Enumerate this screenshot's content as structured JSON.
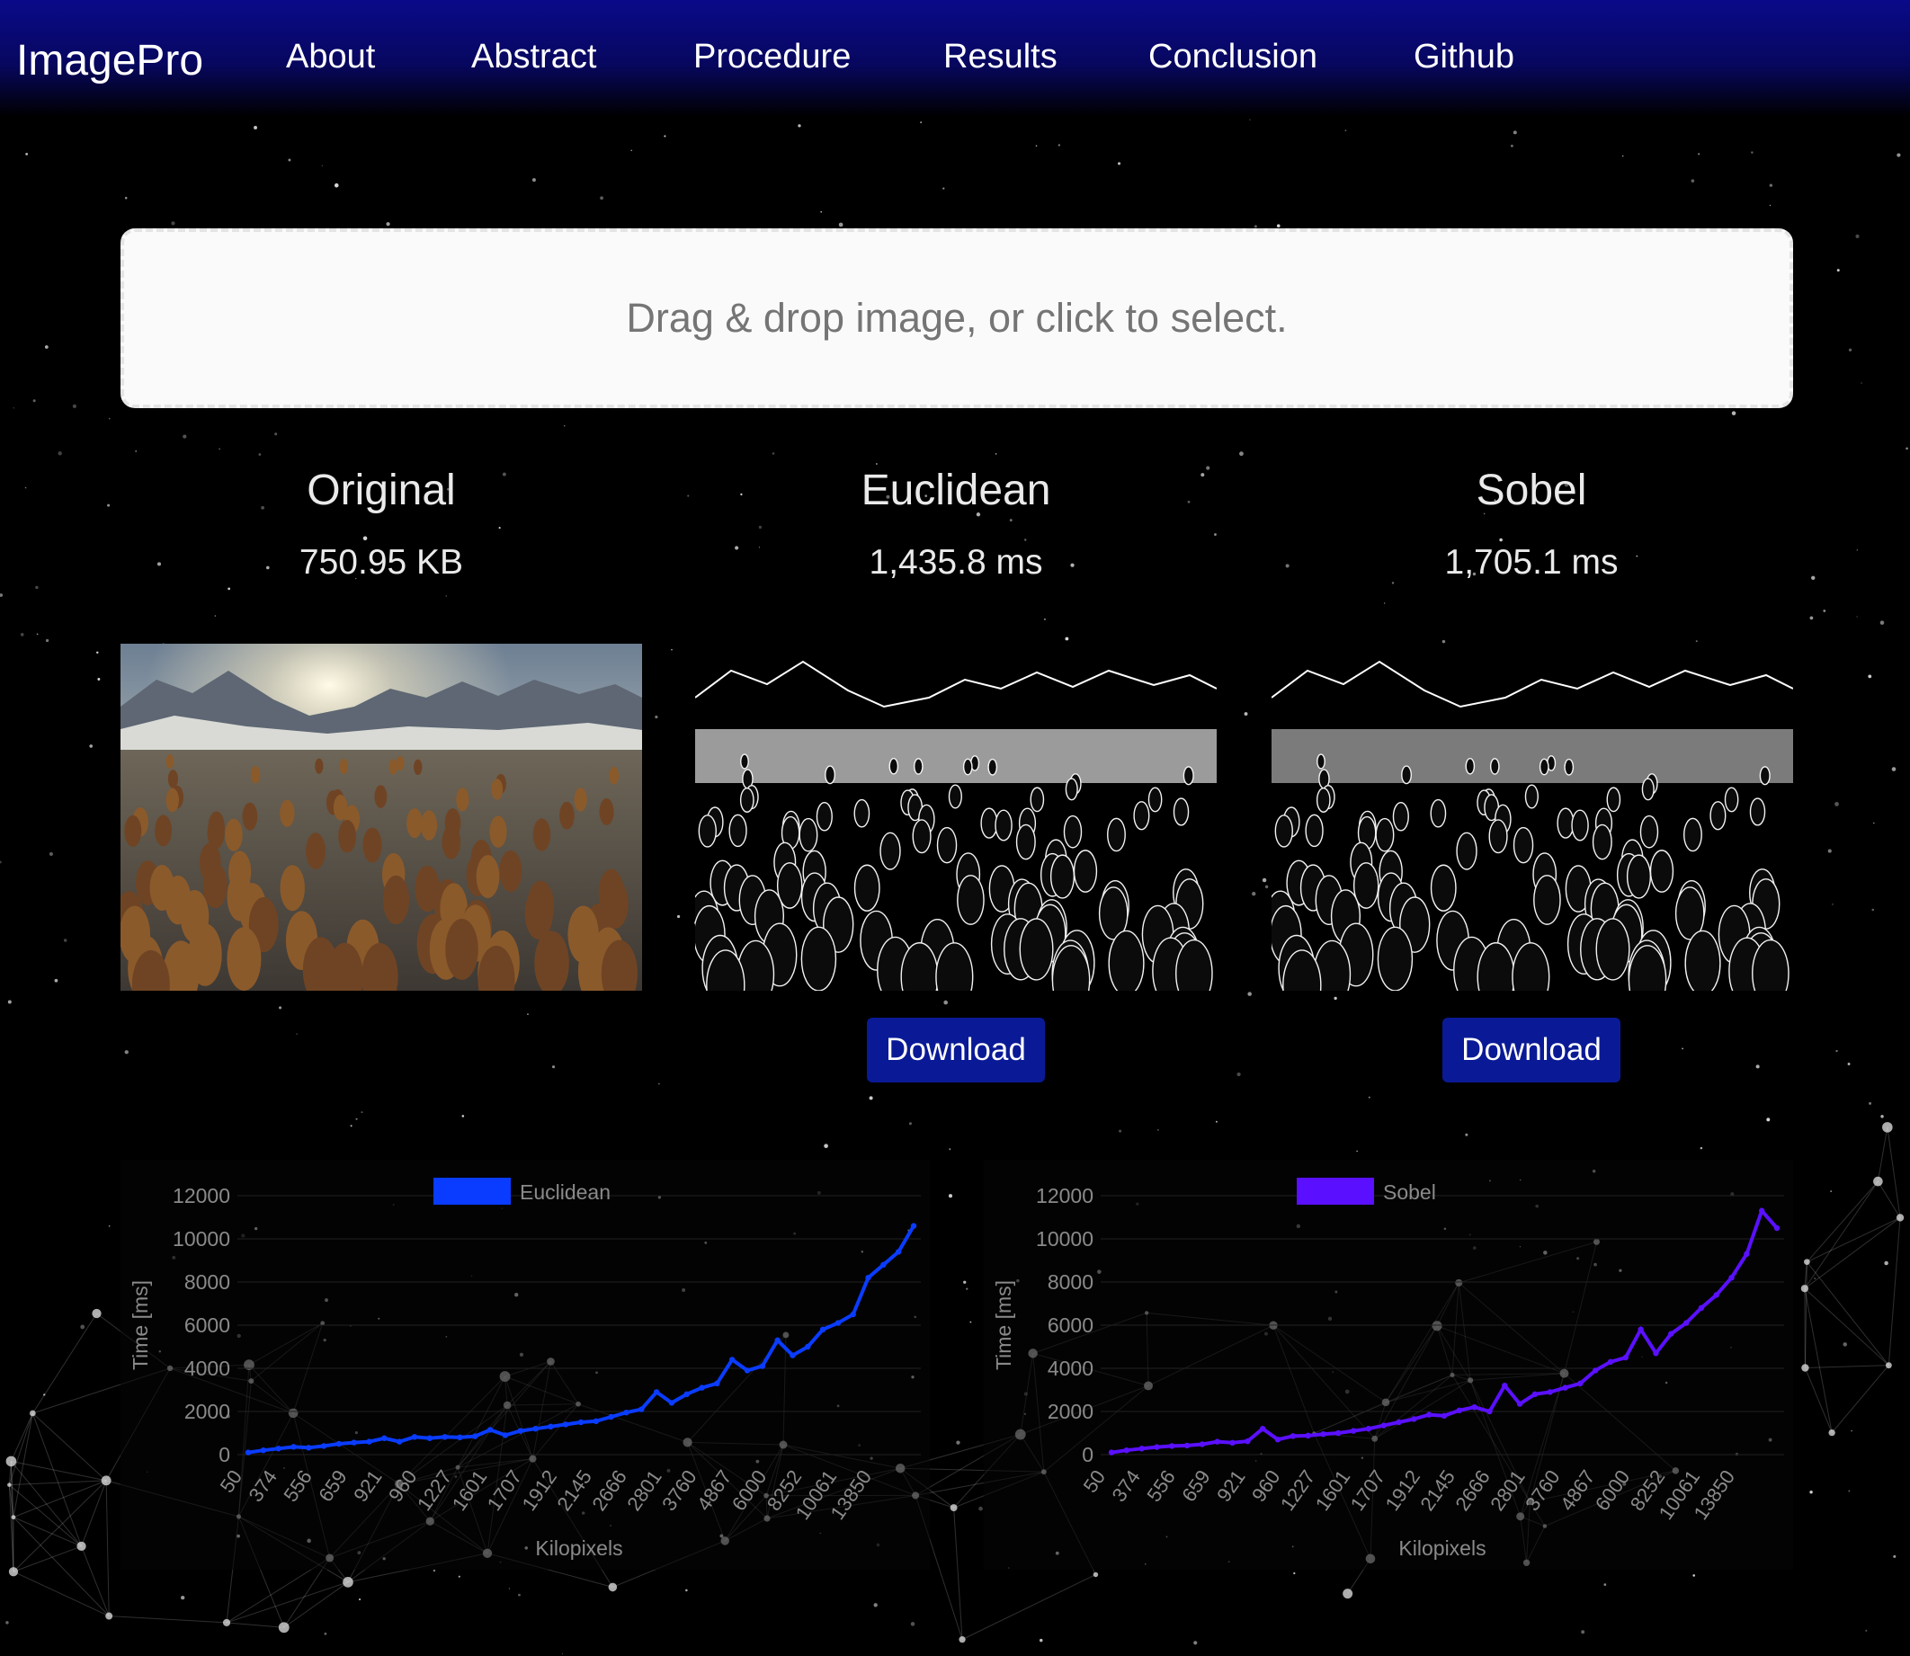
{
  "navbar": {
    "brand": "ImagePro",
    "links": [
      "About",
      "Abstract",
      "Procedure",
      "Results",
      "Conclusion",
      "Github"
    ]
  },
  "dropzone": {
    "text": "Drag & drop image, or click to select."
  },
  "columns": [
    {
      "title": "Original",
      "stat": "750.95 KB"
    },
    {
      "title": "Euclidean",
      "stat": "1,435.8 ms",
      "button": "Download"
    },
    {
      "title": "Sobel",
      "stat": "1,705.1 ms",
      "button": "Download"
    }
  ],
  "chart_data": [
    {
      "type": "line",
      "xlabel": "Kilopixels",
      "ylabel": "Time [ms]",
      "ylim": [
        0,
        12000
      ],
      "yticks": [
        0,
        2000,
        4000,
        6000,
        8000,
        10000,
        12000
      ],
      "x_tick_labels": [
        "50",
        "374",
        "556",
        "659",
        "921",
        "960",
        "1227",
        "1601",
        "1707",
        "1912",
        "2145",
        "2666",
        "2801",
        "3760",
        "4867",
        "6000",
        "8252",
        "10061",
        "13850"
      ],
      "legend_position": "top",
      "series": [
        {
          "name": "Euclidean",
          "color": "#0a3cff",
          "values": [
            100,
            200,
            280,
            360,
            320,
            400,
            500,
            560,
            600,
            760,
            600,
            820,
            760,
            820,
            800,
            850,
            1150,
            900,
            1100,
            1200,
            1300,
            1400,
            1500,
            1550,
            1750,
            1950,
            2100,
            2900,
            2400,
            2800,
            3100,
            3300,
            4400,
            3900,
            4100,
            5300,
            4600,
            5000,
            5800,
            6100,
            6500,
            8200,
            8800,
            9400,
            10600
          ]
        }
      ]
    },
    {
      "type": "line",
      "xlabel": "Kilopixels",
      "ylabel": "Time [ms]",
      "ylim": [
        0,
        12000
      ],
      "yticks": [
        0,
        2000,
        4000,
        6000,
        8000,
        10000,
        12000
      ],
      "x_tick_labels": [
        "50",
        "374",
        "556",
        "659",
        "921",
        "960",
        "1227",
        "1601",
        "1707",
        "1912",
        "2145",
        "2666",
        "2801",
        "3760",
        "4867",
        "6000",
        "8252",
        "10061",
        "13850"
      ],
      "legend_position": "top",
      "series": [
        {
          "name": "Sobel",
          "color": "#5a10ff",
          "values": [
            100,
            200,
            280,
            350,
            400,
            420,
            480,
            600,
            550,
            620,
            1200,
            700,
            860,
            880,
            950,
            1000,
            1100,
            1200,
            1350,
            1500,
            1650,
            1850,
            1800,
            2050,
            2200,
            2000,
            3200,
            2350,
            2800,
            2900,
            3100,
            3300,
            3900,
            4300,
            4500,
            5800,
            4700,
            5600,
            6100,
            6800,
            7400,
            8200,
            9300,
            11300,
            10500
          ]
        }
      ]
    }
  ]
}
